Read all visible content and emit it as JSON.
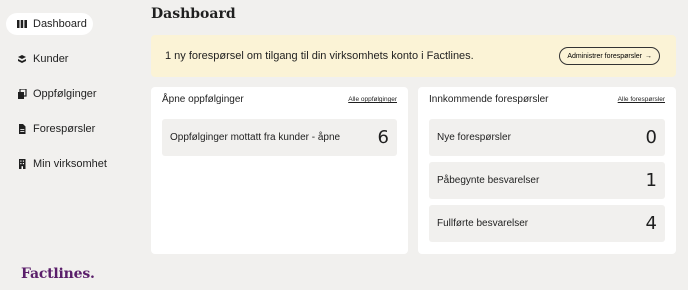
{
  "sidebar": {
    "items": [
      {
        "label": "Dashboard",
        "icon": "dashboard-icon",
        "active": true
      },
      {
        "label": "Kunder",
        "icon": "customers-icon"
      },
      {
        "label": "Oppfølginger",
        "icon": "followups-icon"
      },
      {
        "label": "Forespørsler",
        "icon": "document-icon"
      },
      {
        "label": "Min virksomhet",
        "icon": "building-icon"
      }
    ],
    "logo": "Factlines."
  },
  "main": {
    "title": "Dashboard",
    "banner": {
      "text": "1 ny forespørsel om tilgang til din virksomhets konto i Factlines.",
      "button_label": "Administrer forespørsler",
      "button_icon": "arrow-right-icon"
    },
    "cards": {
      "followups": {
        "title": "Åpne oppfølginger",
        "link": "Alle oppfølginger",
        "rows": [
          {
            "label": "Oppfølginger mottatt fra kunder - åpne",
            "value": "6"
          }
        ]
      },
      "requests": {
        "title": "Innkommende forespørsler",
        "link": "Alle forespørsler",
        "rows": [
          {
            "label": "Nye forespørsler",
            "value": "0"
          },
          {
            "label": "Påbegynte besvarelser",
            "value": "1"
          },
          {
            "label": "Fullførte besvarelser",
            "value": "4"
          }
        ]
      }
    }
  },
  "colors": {
    "background": "#f1f0ee",
    "banner": "#fbf3d6",
    "brand": "#5a1e6a"
  }
}
